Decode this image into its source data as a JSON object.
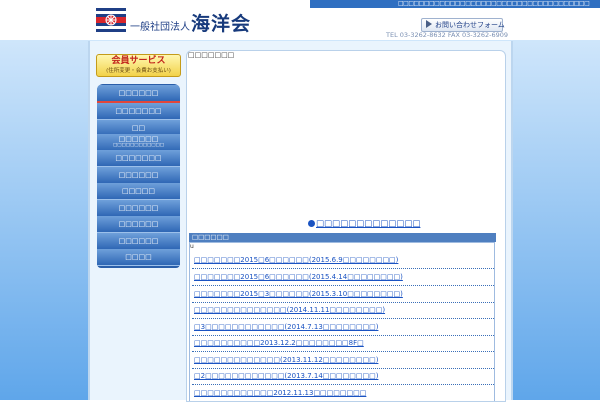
{
  "header": {
    "top_bar_text": "□□□□□□□□□□□□□□□□□□□□□□□□□□□□□□□□□□□□□",
    "org_type": "一般社団法人",
    "org_name": "海洋会",
    "contact_button": "お問い合わせフォーム",
    "tel": "TEL 03-3262-8632 FAX 03-3262-6909"
  },
  "member_service": {
    "title": "会員サービス",
    "subtitle": "(住所変更・会費お支払い)"
  },
  "nav": {
    "items": [
      {
        "label": "□□□□□□"
      },
      {
        "label": "□□□□□□□"
      },
      {
        "label": "□□"
      },
      {
        "label": "□□□□□□",
        "sub": "□□□□□□□□□□□□"
      },
      {
        "label": "□□□□□□□"
      },
      {
        "label": "□□□□□□"
      },
      {
        "label": "□□□□□"
      },
      {
        "label": "□□□□□□"
      },
      {
        "label": "□□□□□□"
      },
      {
        "label": "□□□□□□"
      },
      {
        "label": "□□□□"
      }
    ]
  },
  "breadcrumb": "□□□□□□□",
  "feature_link": "□□□□□□□□□□□□□",
  "news": {
    "header": "□□□□□□",
    "marker": "u",
    "items": [
      "□□□□□□□2015□6□□□□□□(2015.6.9□□□□□□□□)",
      "□□□□□□□2015□6□□□□□□(2015.4.14□□□□□□□□)",
      "□□□□□□□2015□3□□□□□□(2015.3.10□□□□□□□□)",
      "□□□□□□□□□□□□□□(2014.11.11□□□□□□□□)",
      "□3□□□□□□□□□□□□(2014.7.13□□□□□□□□)",
      "□□□□□□□□□□2013.12.2□□□□□□□□8F□",
      "□□□□□□□□□□□□□(2013.11.12□□□□□□□□)",
      "□2□□□□□□□□□□□□(2013.7.14□□□□□□□□)",
      "□□□□□□□□□□□□2012.11.13□□□□□□□□"
    ]
  },
  "colors": {
    "nav_blue": "#2f67b5",
    "link_blue": "#1a53c2",
    "accent_red": "#e2463a",
    "member_yellow": "#f2d24a"
  }
}
